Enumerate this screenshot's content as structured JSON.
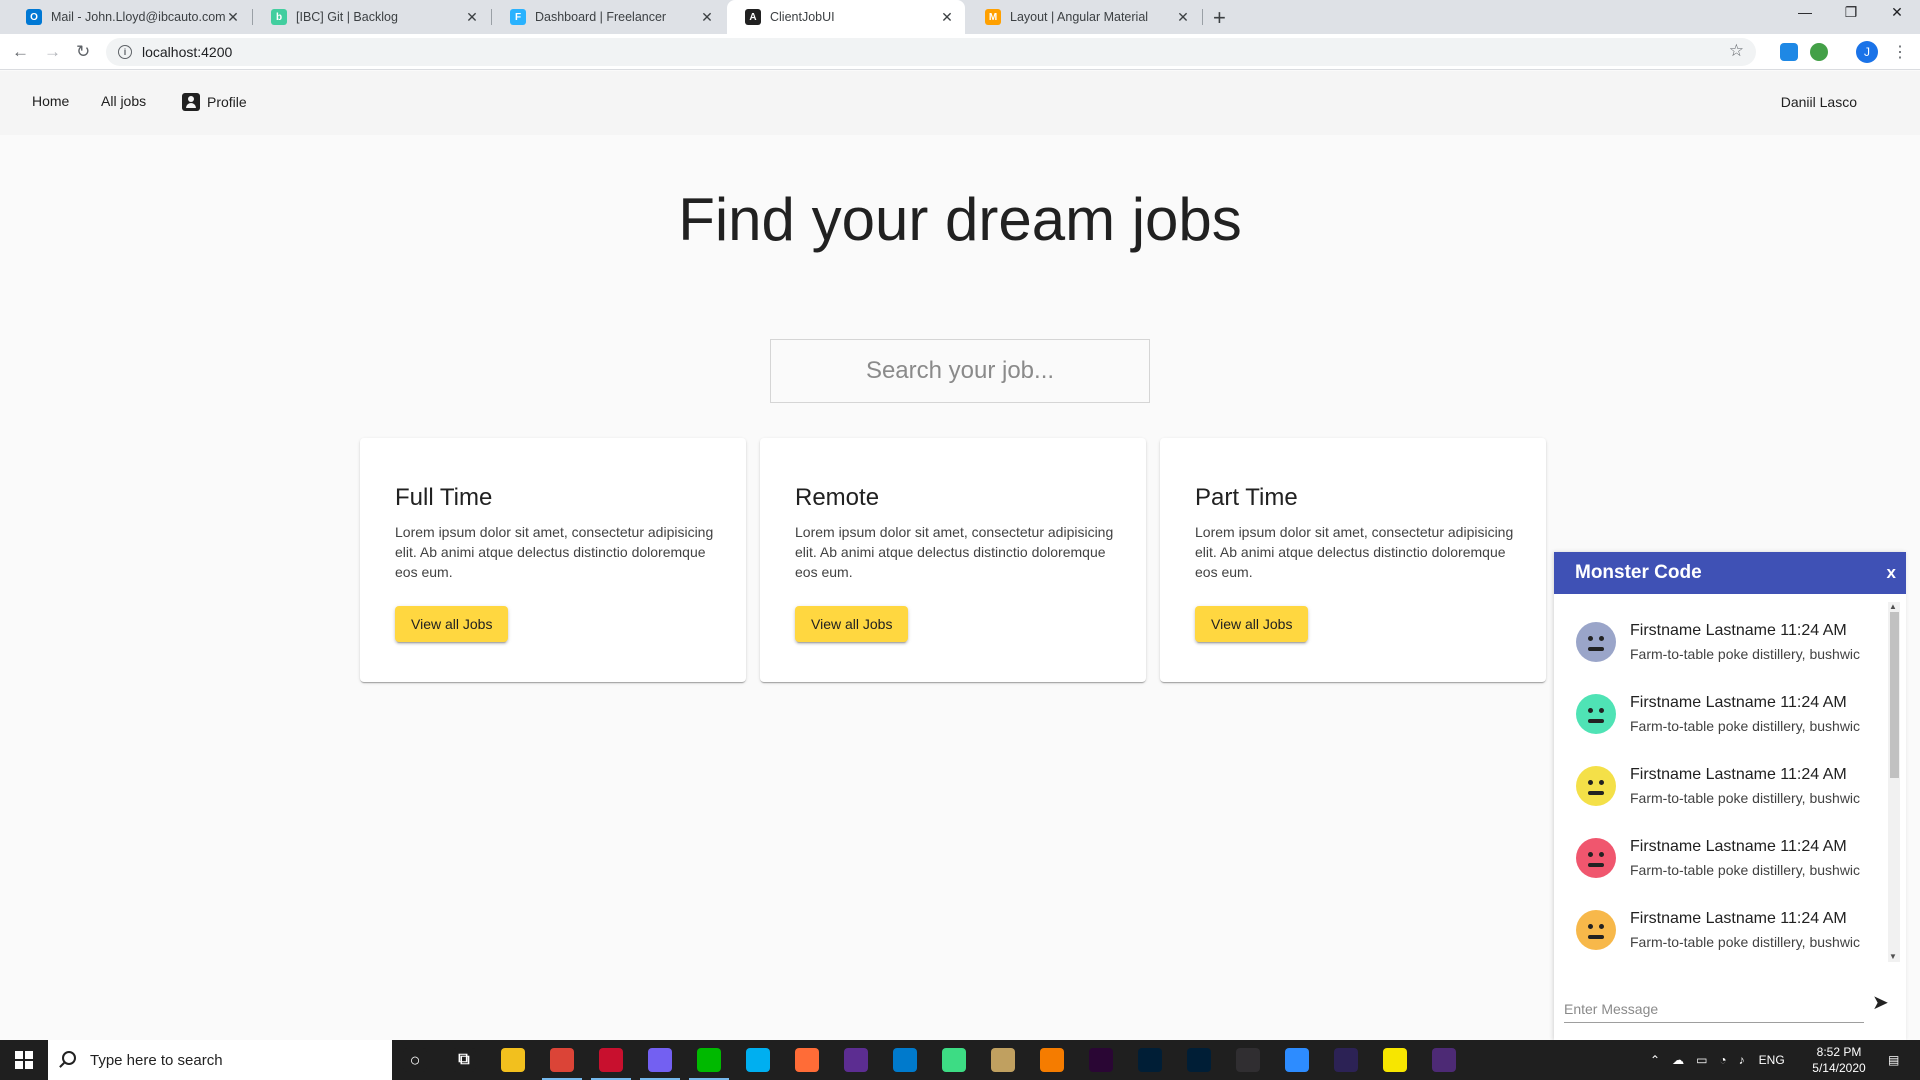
{
  "browser": {
    "tabs": [
      {
        "title": "Mail - John.Lloyd@ibcauto.com",
        "icon": "outlook-icon",
        "color": "#0078d4",
        "glyph": "O"
      },
      {
        "title": "[IBC] Git | Backlog",
        "icon": "backlog-icon",
        "color": "#42ce9f",
        "glyph": "b"
      },
      {
        "title": "Dashboard | Freelancer",
        "icon": "freelancer-icon",
        "color": "#29b2fe",
        "glyph": "F"
      },
      {
        "title": "ClientJobUI",
        "icon": "angular-icon",
        "color": "#212121",
        "glyph": "A"
      },
      {
        "title": "Layout | Angular Material",
        "icon": "angular-material-icon",
        "color": "#ffa000",
        "glyph": "M"
      }
    ],
    "url": "localhost:4200",
    "profile_initial": "J"
  },
  "nav": {
    "home": "Home",
    "all_jobs": "All jobs",
    "profile": "Profile",
    "user_name": "Daniil Lasco"
  },
  "hero": {
    "title": "Find your dream jobs",
    "search_placeholder": "Search your job..."
  },
  "cards": [
    {
      "title": "Full Time",
      "text": "Lorem ipsum dolor sit amet, consectetur adipisicing elit. Ab animi atque delectus distinctio doloremque eos eum.",
      "button": "View all Jobs"
    },
    {
      "title": "Remote",
      "text": "Lorem ipsum dolor sit amet, consectetur adipisicing elit. Ab animi atque delectus distinctio doloremque eos eum.",
      "button": "View all Jobs"
    },
    {
      "title": "Part Time",
      "text": "Lorem ipsum dolor sit amet, consectetur adipisicing elit. Ab animi atque delectus distinctio doloremque eos eum.",
      "button": "View all Jobs"
    }
  ],
  "chat": {
    "title": "Monster Code",
    "close": "x",
    "input_placeholder": "Enter Message",
    "messages": [
      {
        "name": "Firstname Lastname 11:24 AM",
        "text": "Farm-to-table poke distillery, bushwic",
        "color": "#9aa5c9"
      },
      {
        "name": "Firstname Lastname 11:24 AM",
        "text": "Farm-to-table poke distillery, bushwic",
        "color": "#4fe3b5"
      },
      {
        "name": "Firstname Lastname 11:24 AM",
        "text": "Farm-to-table poke distillery, bushwic",
        "color": "#f4e048"
      },
      {
        "name": "Firstname Lastname 11:24 AM",
        "text": "Farm-to-table poke distillery, bushwic",
        "color": "#f0566e"
      },
      {
        "name": "Firstname Lastname 11:24 AM",
        "text": "Farm-to-table poke distillery, bushwic",
        "color": "#f7b84a"
      }
    ]
  },
  "taskbar": {
    "search_placeholder": "Type here to search",
    "time": "8:52 PM",
    "date": "5/14/2020",
    "lang": "ENG",
    "apps": [
      {
        "name": "task-view-icon",
        "color": "#1f1f1f"
      },
      {
        "name": "task-switch-icon",
        "color": "#1f1f1f"
      },
      {
        "name": "file-explorer-icon",
        "color": "#f2c01e"
      },
      {
        "name": "chrome-icon",
        "color": "#db4437"
      },
      {
        "name": "security-app-icon",
        "color": "#c8102e"
      },
      {
        "name": "viber-icon",
        "color": "#7360f2"
      },
      {
        "name": "line-icon",
        "color": "#00b900"
      },
      {
        "name": "skype-icon",
        "color": "#00aff0"
      },
      {
        "name": "postman-icon",
        "color": "#ff6c37"
      },
      {
        "name": "visual-studio-icon",
        "color": "#5c2d91"
      },
      {
        "name": "vscode-icon",
        "color": "#007acc"
      },
      {
        "name": "maps-icon",
        "color": "#3ddc84"
      },
      {
        "name": "tools-icon",
        "color": "#c0a060"
      },
      {
        "name": "headphones-icon",
        "color": "#f57c00"
      },
      {
        "name": "premiere-icon",
        "color": "#2a0634"
      },
      {
        "name": "photoshop-icon",
        "color": "#001e36"
      },
      {
        "name": "lightroom-icon",
        "color": "#001e36"
      },
      {
        "name": "obs-icon",
        "color": "#302e31"
      },
      {
        "name": "zoom-icon",
        "color": "#2d8cff"
      },
      {
        "name": "eclipse-icon",
        "color": "#2c2255"
      },
      {
        "name": "sticky-notes-icon",
        "color": "#f7e600"
      },
      {
        "name": "terminal-icon",
        "color": "#4d2a75"
      }
    ]
  }
}
